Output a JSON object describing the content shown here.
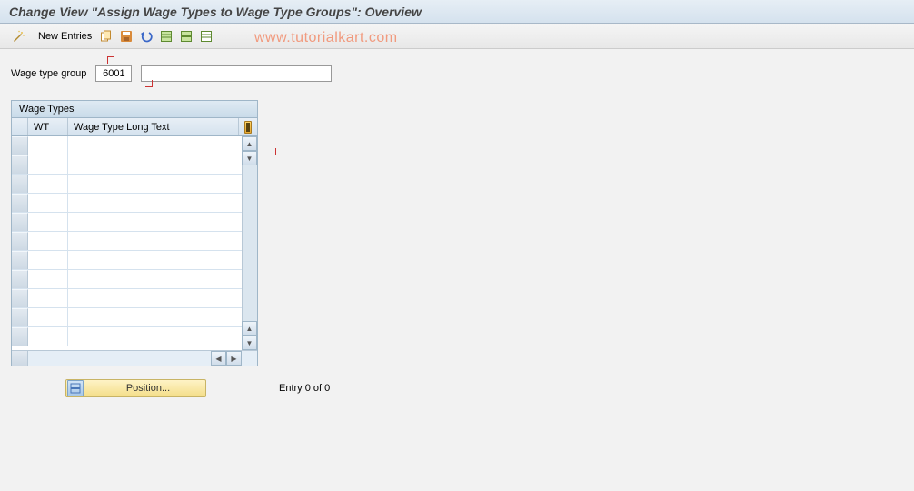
{
  "title": "Change View \"Assign Wage Types to Wage Type Groups\": Overview",
  "toolbar": {
    "new_entries": "New Entries"
  },
  "watermark": "www.tutorialkart.com",
  "form": {
    "group_label": "Wage type group",
    "group_value": "6001",
    "group_desc": ""
  },
  "table": {
    "title": "Wage Types",
    "col_wt": "WT",
    "col_text": "Wage Type Long Text",
    "rows": [
      "",
      "",
      "",
      "",
      "",
      "",
      "",
      "",
      "",
      "",
      ""
    ]
  },
  "footer": {
    "position_label": "Position...",
    "entry_text": "Entry 0 of 0"
  }
}
